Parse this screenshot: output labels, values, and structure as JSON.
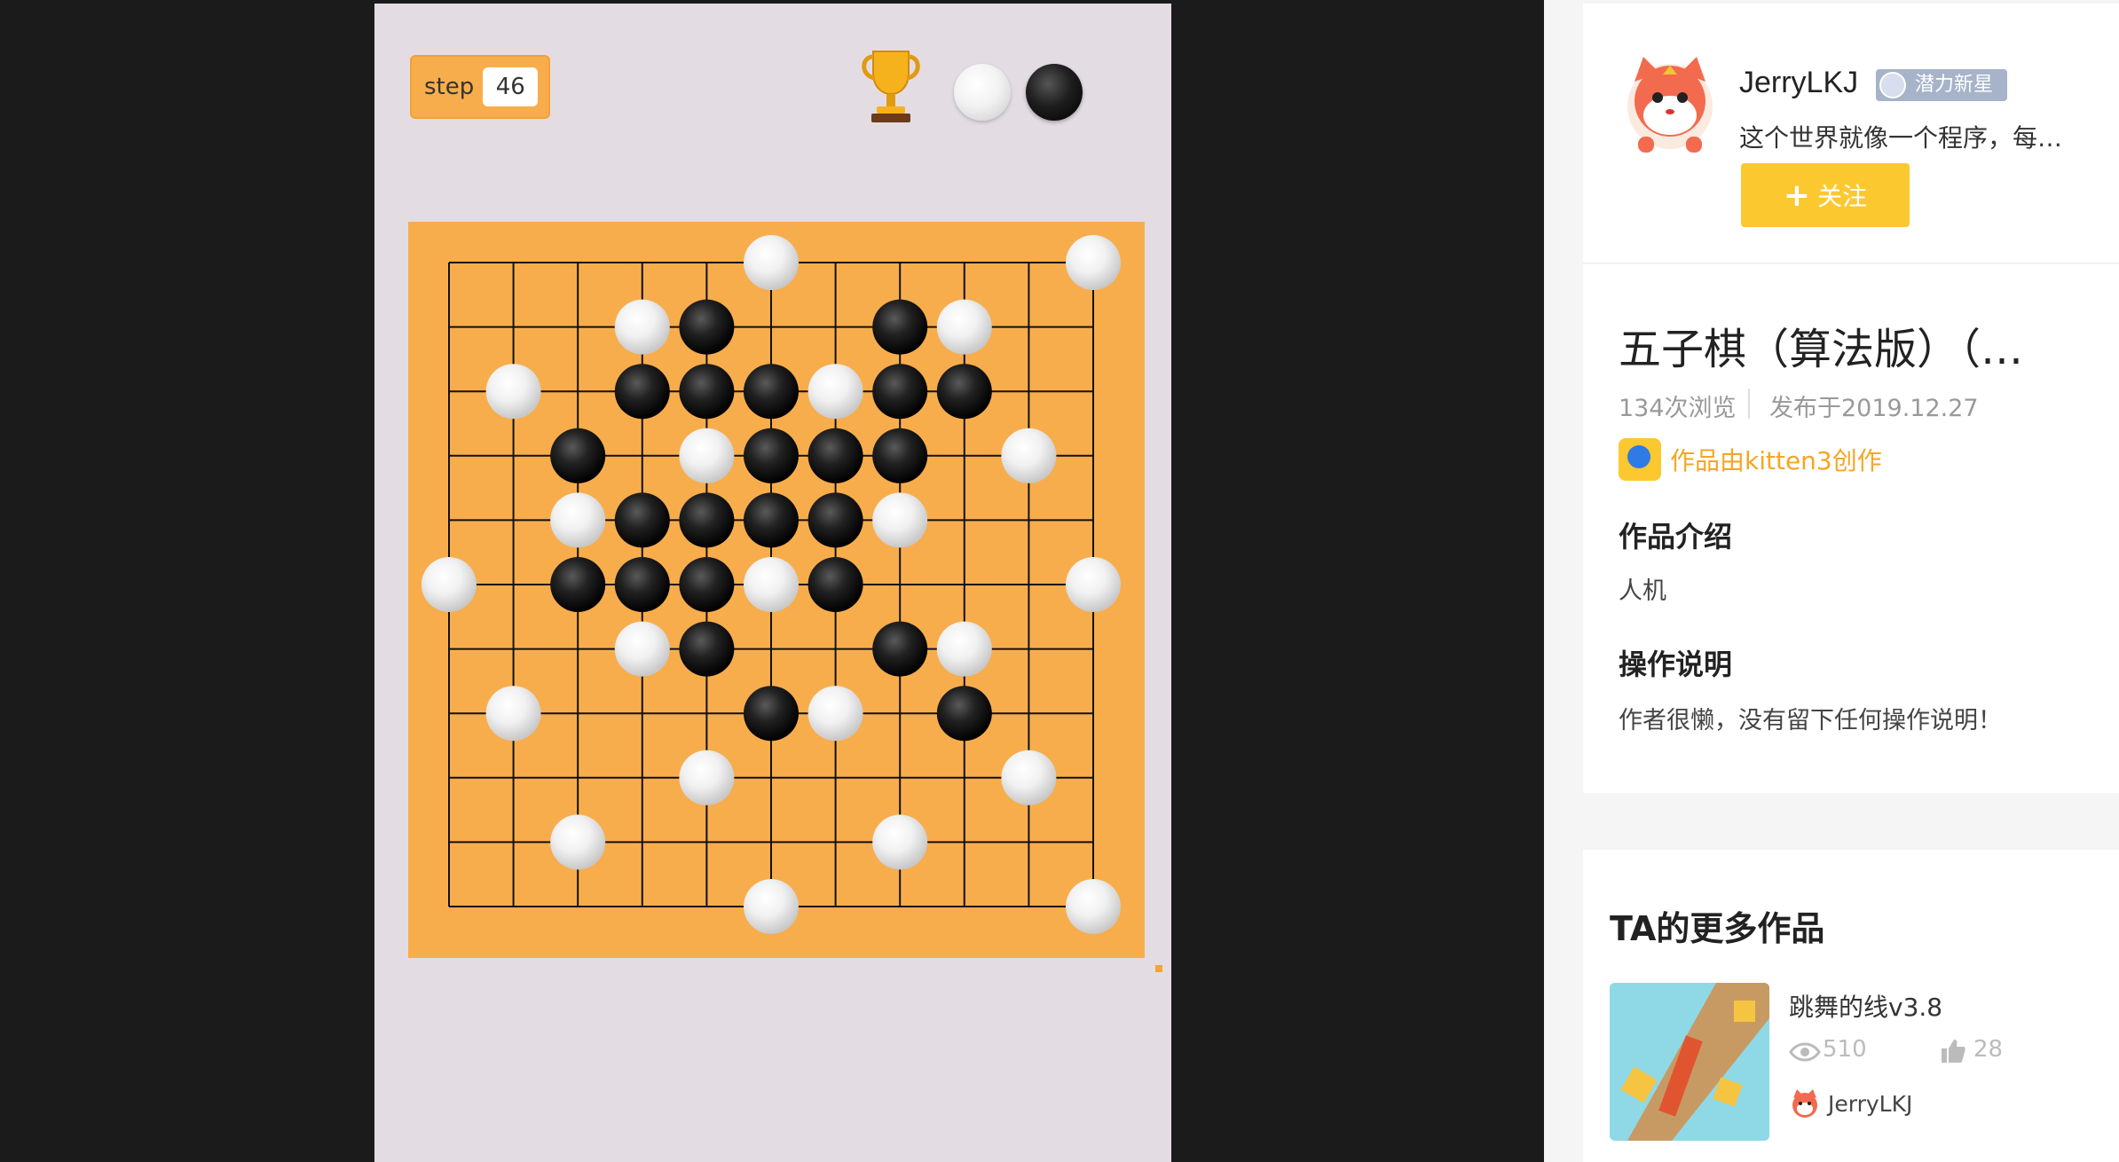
{
  "game": {
    "step_label": "step",
    "step_value": "46",
    "board": {
      "size": 11,
      "colors": {
        "board": "#f8ad4c",
        "lines": "#111111"
      },
      "white": [
        [
          5,
          0
        ],
        [
          10,
          0
        ],
        [
          3,
          1
        ],
        [
          8,
          1
        ],
        [
          1,
          2
        ],
        [
          6,
          2
        ],
        [
          4,
          3
        ],
        [
          9,
          3
        ],
        [
          2,
          4
        ],
        [
          7,
          4
        ],
        [
          0,
          5
        ],
        [
          5,
          5
        ],
        [
          10,
          5
        ],
        [
          3,
          6
        ],
        [
          8,
          6
        ],
        [
          1,
          7
        ],
        [
          6,
          7
        ],
        [
          4,
          8
        ],
        [
          9,
          8
        ],
        [
          2,
          9
        ],
        [
          7,
          9
        ],
        [
          5,
          10
        ],
        [
          10,
          10
        ]
      ],
      "black": [
        [
          4,
          1
        ],
        [
          7,
          1
        ],
        [
          3,
          2
        ],
        [
          4,
          2
        ],
        [
          5,
          2
        ],
        [
          7,
          2
        ],
        [
          8,
          2
        ],
        [
          2,
          3
        ],
        [
          5,
          3
        ],
        [
          6,
          3
        ],
        [
          7,
          3
        ],
        [
          3,
          4
        ],
        [
          4,
          4
        ],
        [
          5,
          4
        ],
        [
          6,
          4
        ],
        [
          2,
          5
        ],
        [
          3,
          5
        ],
        [
          4,
          5
        ],
        [
          6,
          5
        ],
        [
          4,
          6
        ],
        [
          7,
          6
        ],
        [
          5,
          7
        ],
        [
          8,
          7
        ]
      ]
    }
  },
  "author": {
    "name": "JerryLKJ",
    "badge": "潜力新星",
    "bio": "这个世界就像一个程序，每…",
    "follow_label": "关注"
  },
  "work": {
    "title": "五子棋（算法版）（…",
    "views": "134次浏览",
    "published": "发布于2019.12.27",
    "made_by": "作品由kitten3创作",
    "intro_heading": "作品介绍",
    "intro_text": "人机",
    "op_heading": "操作说明",
    "op_text": "作者很懒，没有留下任何操作说明！"
  },
  "more_works": {
    "heading": "TA的更多作品",
    "items": [
      {
        "title": "跳舞的线v3.8",
        "views": "510",
        "likes": "28",
        "author": "JerryLKJ"
      }
    ]
  },
  "icons": {
    "trophy": "trophy-icon",
    "white_stone": "white-stone-icon",
    "black_stone": "black-stone-icon",
    "plus": "plus-icon",
    "eye": "eye-icon",
    "thumbs_up": "thumbs-up-icon"
  }
}
